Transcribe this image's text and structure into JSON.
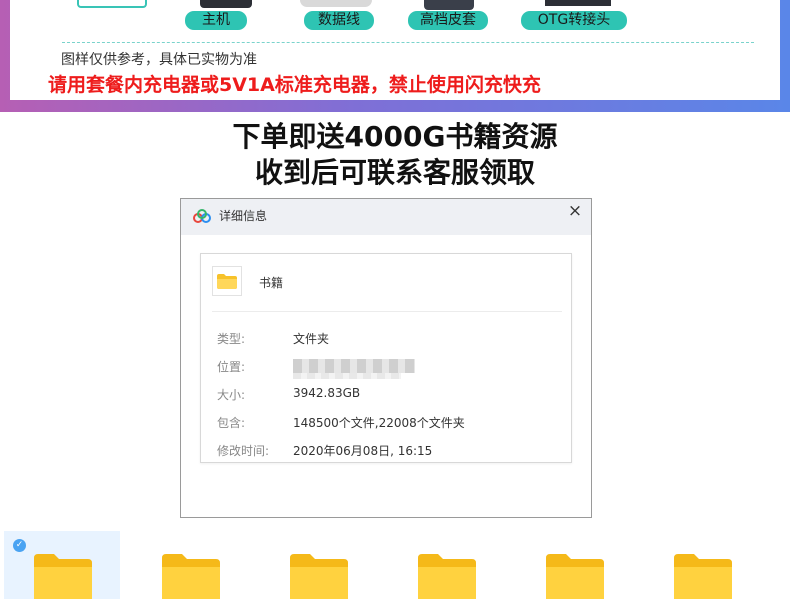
{
  "banner": {
    "accessories": [
      "主机",
      "数据线",
      "高档皮套",
      "OTG转接头"
    ],
    "note": "图样仅供参考，具体已实物为准",
    "warning": "请用套餐内充电器或5V1A标准充电器，禁止使用闪充快充",
    "colors": {
      "pill": "#2ec4b3",
      "warning": "#ee1c1c"
    }
  },
  "headline": {
    "line1": "下单即送4000G书籍资源",
    "line2": "收到后可联系客服领取"
  },
  "dialog": {
    "title": "详细信息",
    "close_icon": "×",
    "file_name": "书籍",
    "rows": [
      {
        "label": "类型:",
        "value": "文件夹"
      },
      {
        "label": "位置:",
        "value": ""
      },
      {
        "label": "大小:",
        "value": "3942.83GB"
      },
      {
        "label": "包含:",
        "value": "148500个文件,22008个文件夹"
      },
      {
        "label": "修改时间:",
        "value": "2020年06月08日, 16:15"
      }
    ]
  },
  "folder_grid": {
    "icon": "folder-icon",
    "selected_check": "✓"
  }
}
